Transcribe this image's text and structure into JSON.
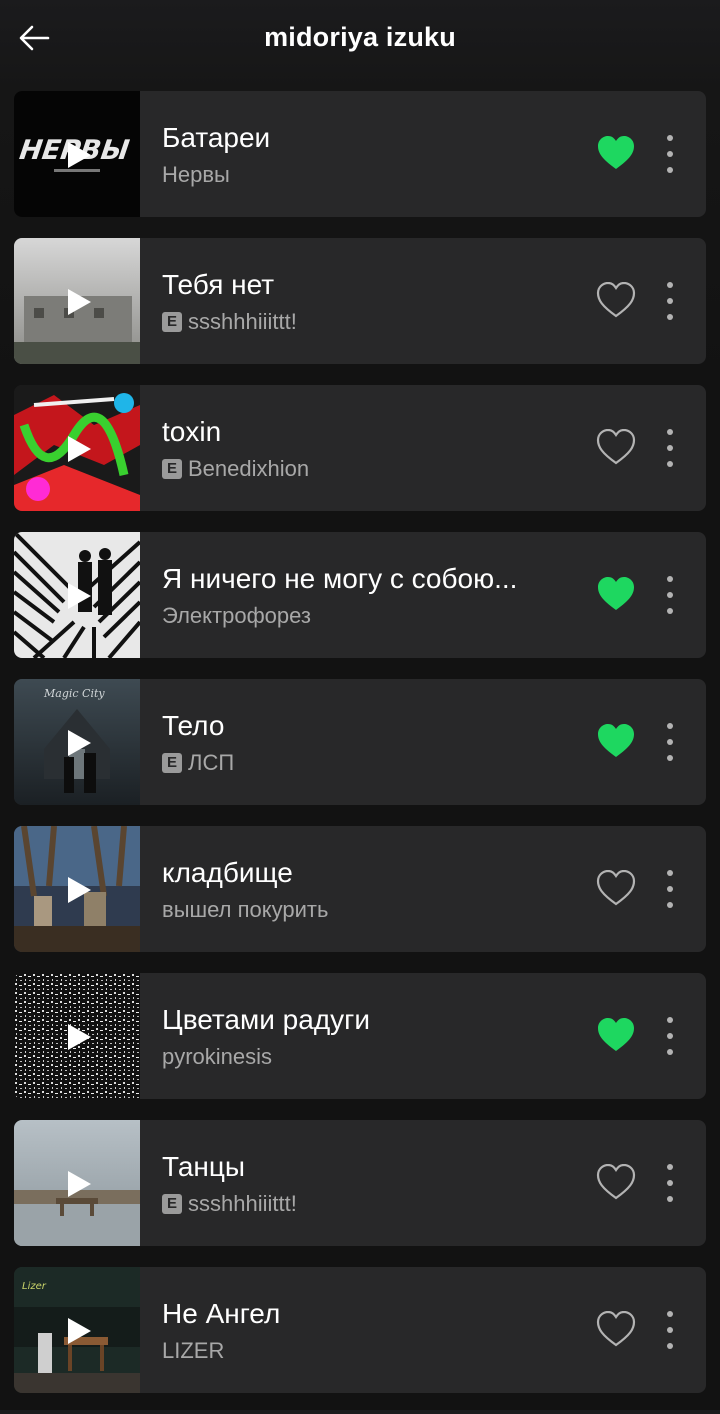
{
  "header": {
    "title": "midoriya izuku",
    "back_icon": "arrow-left-icon"
  },
  "colors": {
    "accent": "#1ed760",
    "card": "#282829",
    "subtext": "#a8a8a8"
  },
  "tracks": [
    {
      "title": "Батареи",
      "artist": "Нервы",
      "explicit": false,
      "liked": true,
      "explicit_label": ""
    },
    {
      "title": "Тебя нет",
      "artist": "ssshhhiiittt!",
      "explicit": true,
      "liked": false,
      "explicit_label": "E"
    },
    {
      "title": "toxin",
      "artist": "Benedixhion",
      "explicit": true,
      "liked": false,
      "explicit_label": "E"
    },
    {
      "title": "Я ничего не могу с собою...",
      "artist": "Электрофорез",
      "explicit": false,
      "liked": true,
      "explicit_label": ""
    },
    {
      "title": "Тело",
      "artist": "ЛСП",
      "explicit": true,
      "liked": true,
      "explicit_label": "E"
    },
    {
      "title": "кладбище",
      "artist": "вышел покурить",
      "explicit": false,
      "liked": false,
      "explicit_label": ""
    },
    {
      "title": "Цветами радуги",
      "artist": "pyrokinesis",
      "explicit": false,
      "liked": true,
      "explicit_label": ""
    },
    {
      "title": "Танцы",
      "artist": "ssshhhiiittt!",
      "explicit": true,
      "liked": false,
      "explicit_label": "E"
    },
    {
      "title": "Не Ангел",
      "artist": "LIZER",
      "explicit": false,
      "liked": false,
      "explicit_label": ""
    }
  ]
}
